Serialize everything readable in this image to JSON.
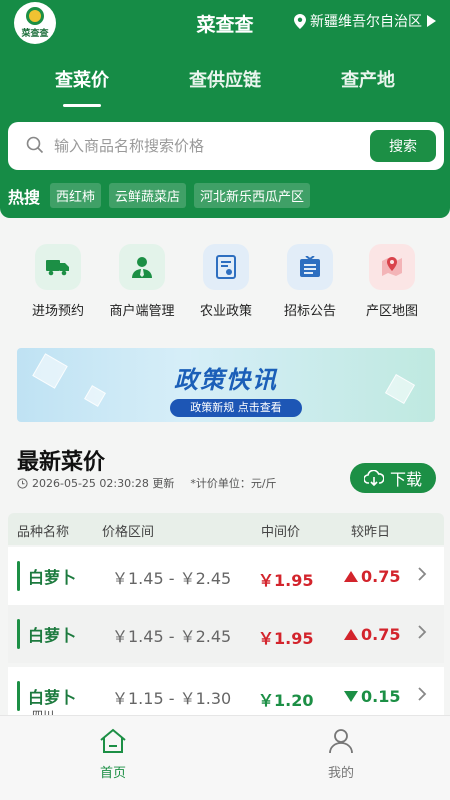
{
  "header": {
    "logo_text": "菜查查",
    "title": "菜查查",
    "region": "新疆维吾尔自治区"
  },
  "tabs": [
    {
      "label": "查菜价",
      "active": true
    },
    {
      "label": "查供应链",
      "active": false
    },
    {
      "label": "查产地",
      "active": false
    }
  ],
  "search": {
    "placeholder": "输入商品名称搜索价格",
    "button": "搜索"
  },
  "hot": {
    "label": "热搜",
    "tags": [
      "西红柿",
      "云鲜蔬菜店",
      "河北新乐西瓜产区"
    ]
  },
  "quick_links": [
    {
      "label": "进场预约",
      "icon": "truck-icon",
      "bg": "#e3f3ea",
      "color": "#1c8f45"
    },
    {
      "label": "商户端管理",
      "icon": "merchant-user-icon",
      "bg": "#e3f3ea",
      "color": "#1c8f45"
    },
    {
      "label": "农业政策",
      "icon": "policy-document-icon",
      "bg": "#e2edf8",
      "color": "#2e6fc0"
    },
    {
      "label": "招标公告",
      "icon": "announcement-board-icon",
      "bg": "#e2edf8",
      "color": "#2e6fc0"
    },
    {
      "label": "产区地图",
      "icon": "map-pin-icon",
      "bg": "#fbe5e5",
      "color": "#d9434b"
    }
  ],
  "banner": {
    "title": "政策快讯",
    "subtitle": "政策新规 点击查看"
  },
  "latest": {
    "title": "最新菜价",
    "updated": "2026-05-25 02:30:28 更新",
    "unit": "*计价单位：元/斤",
    "download": "下载"
  },
  "table": {
    "headers": [
      "品种名称",
      "价格区间",
      "中间价",
      "较昨日"
    ],
    "rows": [
      {
        "name": "白萝卜",
        "range": "￥1.45 - ￥2.45",
        "mid": "￥1.95",
        "change": "0.75",
        "direction": "up",
        "extra": ""
      },
      {
        "name": "白萝卜",
        "range": "￥1.45 - ￥2.45",
        "mid": "￥1.95",
        "change": "0.75",
        "direction": "up",
        "extra": ""
      },
      {
        "name": "白萝卜",
        "range": "￥1.15 - ￥1.30",
        "mid": "￥1.20",
        "change": "0.15",
        "direction": "down",
        "extra": "四川"
      }
    ]
  },
  "tabbar": [
    {
      "label": "首页",
      "icon": "home-icon",
      "active": true
    },
    {
      "label": "我的",
      "icon": "user-icon",
      "active": false
    }
  ],
  "colors": {
    "primary": "#1c8f45",
    "up": "#d3242c",
    "down": "#1c8f45"
  }
}
